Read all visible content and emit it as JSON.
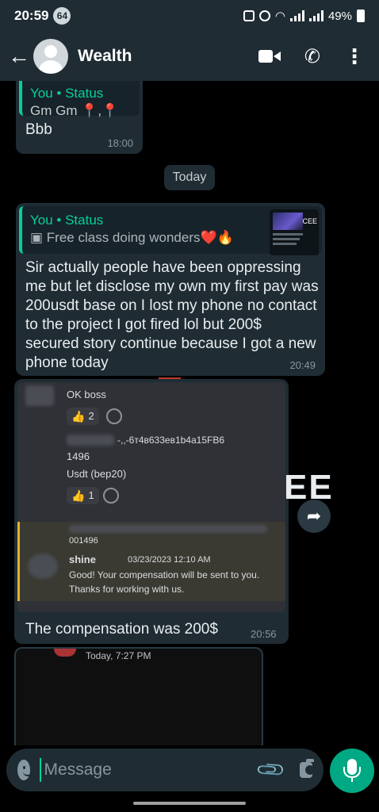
{
  "status_bar": {
    "time": "20:59",
    "notification_count": "64",
    "battery": "49%"
  },
  "header": {
    "title": "Wealth"
  },
  "messages": [
    {
      "quote_author": "You • Status",
      "quote_text": "Gm Gm 📍,📍",
      "text": "Bbb",
      "time": "18:00"
    },
    {
      "quote_author": "You • Status",
      "quote_text": "▣ Free class doing wonders❤️🔥",
      "text": "Sir actually people have been oppressing me but let disclose my own my first pay was  200usdt base on I lost my phone no contact to the project I got fired lol but 200$ secured story continue because I got a new phone today",
      "time": "20:49"
    },
    {
      "text": "The compensation was 200$",
      "time": "20:56"
    }
  ],
  "date_separator": "Today",
  "thumb_label": "CEE",
  "screenshot": {
    "line1": "OK boss",
    "reaction1_count": "2",
    "wallet_fragment": "-,,-6т4в633ев1b4a15FB6",
    "wallet_tail": "1496",
    "line2": "Usdt (bep20)",
    "reaction2_count": "1",
    "reply_wallet": "001496",
    "reply_user": "shine",
    "reply_date": "03/23/2023 12:10 AM",
    "reply_line1": "Good! Your compensation will be sent to you.",
    "reply_line2": "Thanks for working with us."
  },
  "overlay_text": "EE",
  "bottom_shot_text": "Today, 7:27 PM",
  "composer": {
    "placeholder": "Message"
  },
  "colors": {
    "accent": "#06cf9c",
    "bubble": "#1f2c34",
    "mic": "#00a884"
  }
}
